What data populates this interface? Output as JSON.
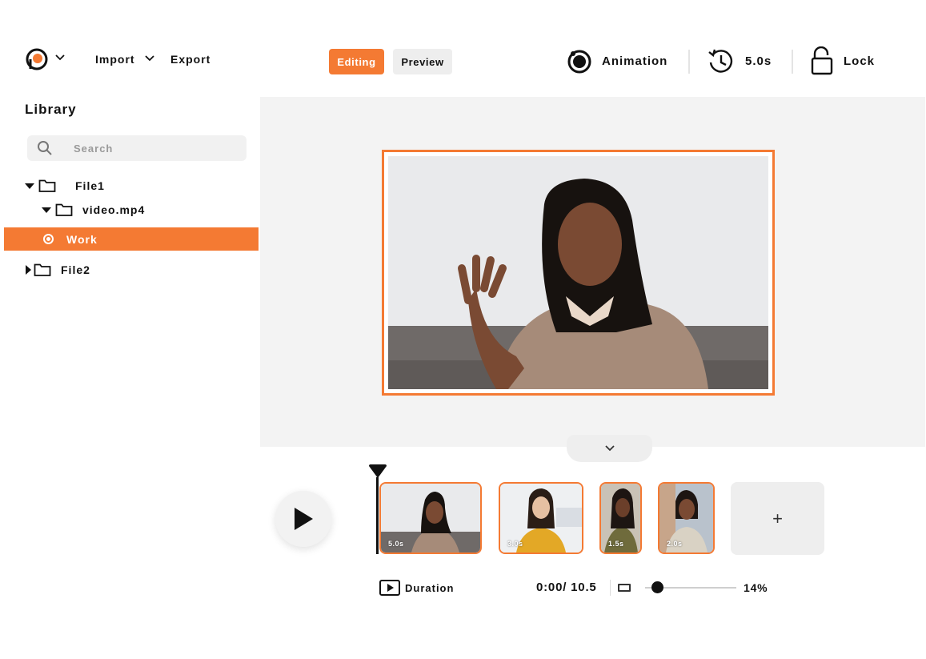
{
  "topbar": {
    "menu_import": "Import",
    "menu_export": "Export",
    "mode_editing": "Editing",
    "mode_preview": "Preview",
    "animation_label": "Animation",
    "duration_label": "5.0s",
    "lock_label": "Lock"
  },
  "sidebar": {
    "title": "Library",
    "search_placeholder": "Search",
    "tree": {
      "file1": "File1",
      "video": "video.mp4",
      "work": "Work",
      "file2": "File2"
    }
  },
  "timeline": {
    "clips": [
      {
        "duration": "5.0s"
      },
      {
        "duration": "3.0s"
      },
      {
        "duration": "1.5s"
      },
      {
        "duration": "2.0s"
      }
    ],
    "add_label": "+"
  },
  "controls": {
    "duration_label": "Duration",
    "time_readout": "0:00/ 10.5",
    "zoom_value": 0.14,
    "zoom_label": "14%"
  },
  "colors": {
    "accent": "#f47a33",
    "canvas_bg": "#f3f3f3"
  },
  "icons": {
    "logo": "brand-logo-icon",
    "animation": "record-circle-icon",
    "duration": "timer-clock-icon",
    "lock": "unlock-padlock-icon",
    "search": "search-icon",
    "play": "play-icon"
  }
}
